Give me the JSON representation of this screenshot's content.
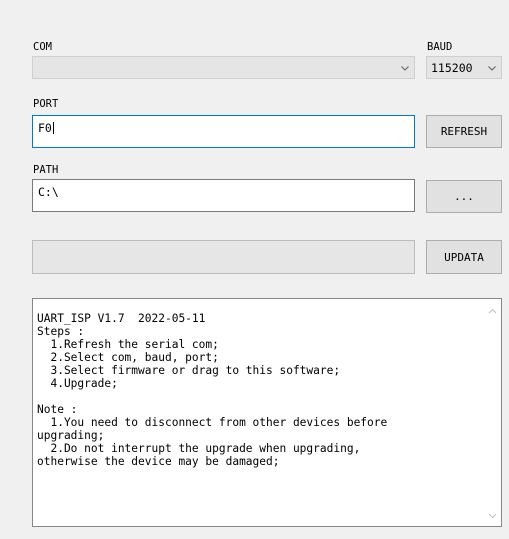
{
  "com": {
    "label": "COM",
    "value": ""
  },
  "baud": {
    "label": "BAUD",
    "value": "115200"
  },
  "port": {
    "label": "PORT",
    "value": "F0"
  },
  "refresh_button": "REFRESH",
  "path": {
    "label": "PATH",
    "value": "C:\\"
  },
  "browse_button": "...",
  "progress": {
    "fraction": 0
  },
  "update_button": "UPDATA",
  "log": {
    "lines": [
      "UART_ISP V1.7  2022-05-11",
      "Steps :",
      "  1.Refresh the serial com;",
      "  2.Select com, baud, port;",
      "  3.Select firmware or drag to this software;",
      "  4.Upgrade;",
      "",
      "Note :",
      "  1.You need to disconnect from other devices before",
      "upgrading;",
      "  2.Do not interrupt the upgrade when upgrading,",
      "otherwise the device may be damaged;"
    ]
  },
  "colors": {
    "window_bg": "#f0f0f0",
    "focus_border": "#0078d7",
    "progress_fill": "#06b025"
  },
  "icons": {
    "dropdown": "chevron-down-icon",
    "scroll_up": "scroll-up-arrow-icon",
    "scroll_down": "scroll-down-arrow-icon"
  }
}
